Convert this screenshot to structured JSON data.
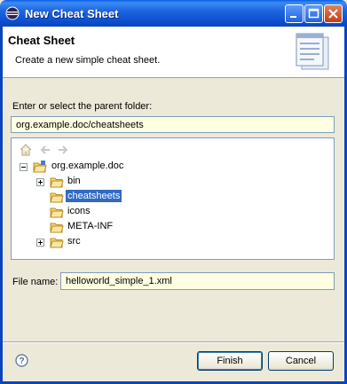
{
  "window": {
    "title": "New Cheat Sheet"
  },
  "banner": {
    "title": "Cheat Sheet",
    "description": "Create a new simple cheat sheet.",
    "icon": "cheatsheet-wizard-icon"
  },
  "parent": {
    "label": "Enter or select the parent folder:",
    "value": "org.example.doc/cheatsheets"
  },
  "tree": {
    "toolbar": [
      "home-icon",
      "back-icon",
      "forward-icon"
    ],
    "root": {
      "label": "org.example.doc",
      "expanded": true
    },
    "children": [
      {
        "label": "bin",
        "expandable": true,
        "selected": false
      },
      {
        "label": "cheatsheets",
        "expandable": false,
        "selected": true
      },
      {
        "label": "icons",
        "expandable": false,
        "selected": false
      },
      {
        "label": "META-INF",
        "expandable": false,
        "selected": false
      },
      {
        "label": "src",
        "expandable": true,
        "selected": false
      }
    ]
  },
  "file": {
    "label": "File name:",
    "value": "helloworld_simple_1.xml"
  },
  "buttons": {
    "finish": "Finish",
    "cancel": "Cancel"
  },
  "colors": {
    "selection": "#316ac5",
    "field_bg": "#ffffe1",
    "titlebar": "#0a45c0"
  }
}
